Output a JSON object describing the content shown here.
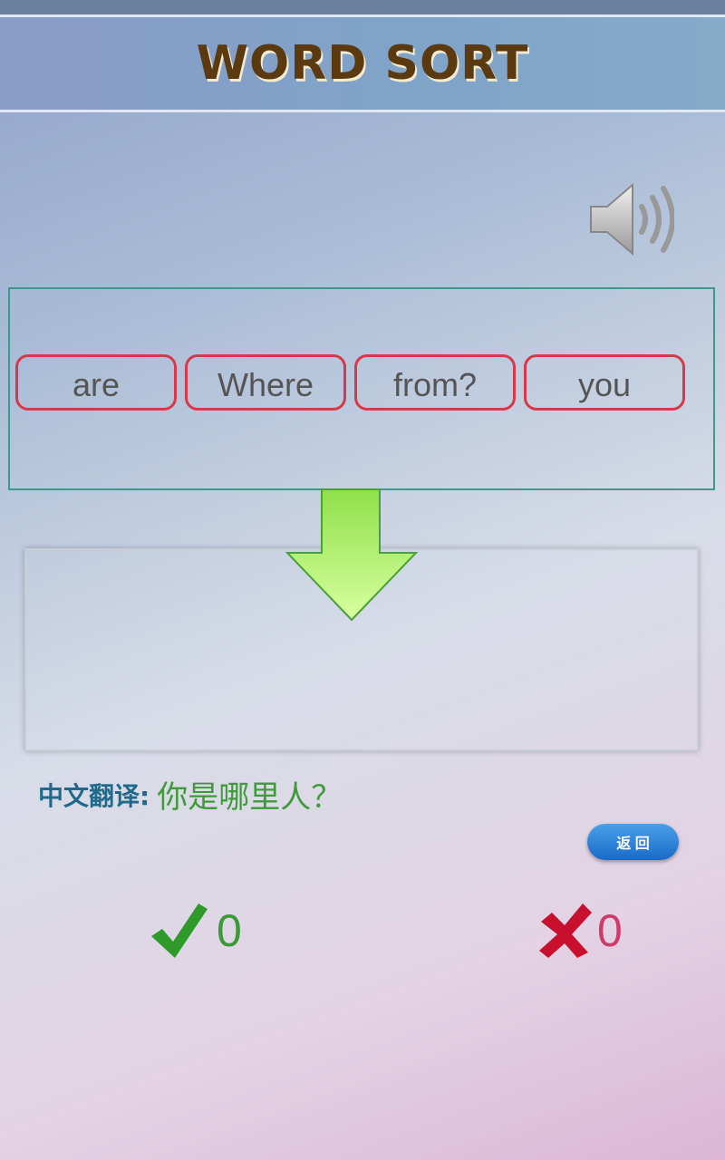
{
  "header": {
    "title": "WORD SORT"
  },
  "words": [
    "are",
    "Where",
    "from?",
    "you"
  ],
  "translation": {
    "label": "中文翻译:",
    "text": "你是哪里人？"
  },
  "back_button": "返 回",
  "score": {
    "correct": "0",
    "wrong": "0"
  },
  "icons": {
    "speaker": "speaker-icon",
    "arrow": "arrow-down-icon",
    "correct": "checkmark-icon",
    "wrong": "cross-icon"
  },
  "colors": {
    "correct": "#2e9a2a",
    "wrong": "#c8102e",
    "word_border": "#d8384a"
  }
}
